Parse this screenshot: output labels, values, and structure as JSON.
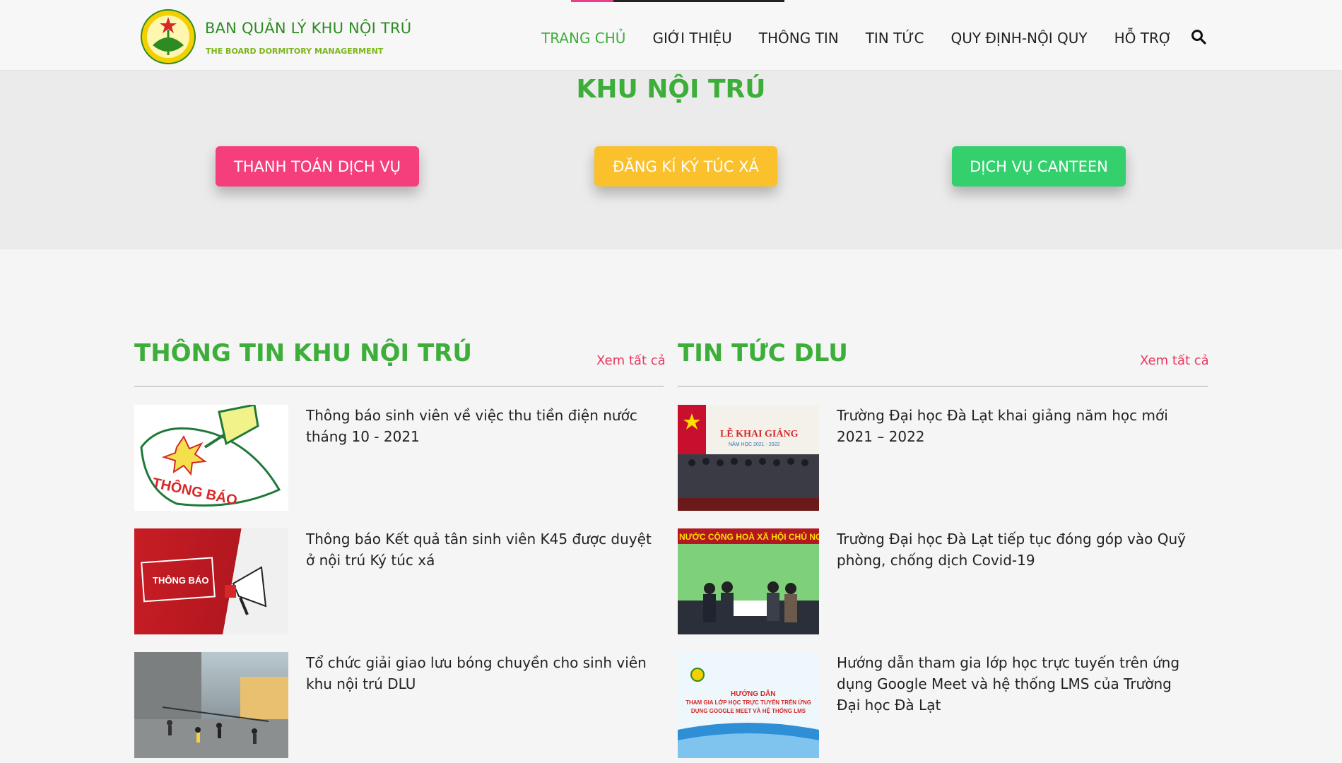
{
  "brand": {
    "title": "BAN QUẢN LÝ KHU NỘI TRÚ",
    "subtitle": "THE BOARD DORMITORY MANAGERMENT"
  },
  "nav": {
    "items": [
      {
        "label": "TRANG CHỦ",
        "active": true
      },
      {
        "label": "GIỚI THIỆU"
      },
      {
        "label": "THÔNG TIN"
      },
      {
        "label": "TIN TỨC"
      },
      {
        "label": "QUY ĐỊNH-NỘI QUY"
      },
      {
        "label": "HỖ TRỢ"
      }
    ],
    "search_icon": "search-icon"
  },
  "hero": {
    "title": "KHU NỘI TRÚ",
    "buttons": [
      {
        "label": "THANH TOÁN DỊCH VỤ",
        "color": "#f53f7d"
      },
      {
        "label": "ĐĂNG KÍ KÝ TÚC XÁ",
        "color": "#fbc12d"
      },
      {
        "label": "DỊCH VỤ CANTEEN",
        "color": "#34d06d"
      }
    ]
  },
  "colors": {
    "accent_green": "#3dae3a",
    "link_pink": "#e8385f"
  },
  "sections": {
    "left": {
      "title": "THÔNG TIN KHU NỘI TRÚ",
      "see_all": "Xem tất cả",
      "items": [
        {
          "title": "Thông báo sinh viên về việc thu tiền điện nước tháng 10 - 2021",
          "thumb_text": "THÔNG BÁO"
        },
        {
          "title": "Thông báo Kết quả tân sinh viên K45 được duyệt ở nội trú Ký túc xá",
          "thumb_text": "THÔNG BÁO"
        },
        {
          "title": "Tổ chức giải giao lưu bóng chuyền cho sinh viên khu nội trú DLU"
        }
      ]
    },
    "right": {
      "title": "TIN TỨC DLU",
      "see_all": "Xem tất cả",
      "items": [
        {
          "title": "Trường Đại học Đà Lạt khai giảng năm học mới 2021 – 2022",
          "thumb_text": "LỄ KHAI GIẢNG",
          "thumb_sub": "NĂM HỌC 2021 - 2022"
        },
        {
          "title": "Trường Đại học Đà Lạt tiếp tục đóng góp vào Quỹ phòng, chống dịch Covid-19",
          "thumb_text": "NƯỚC CỘNG HOÀ XÃ HỘI CHỦ NG"
        },
        {
          "title": "Hướng dẫn tham gia lớp học trực tuyến trên ứng dụng Google Meet và hệ thống LMS của Trường Đại học Đà Lạt",
          "thumb_text": "HƯỚNG DẪN",
          "thumb_sub": "THAM GIA LỚP HỌC TRỰC TUYẾN TRÊN ỨNG DỤNG GOOGLE MEET VÀ HỆ THỐNG LMS"
        }
      ]
    }
  }
}
